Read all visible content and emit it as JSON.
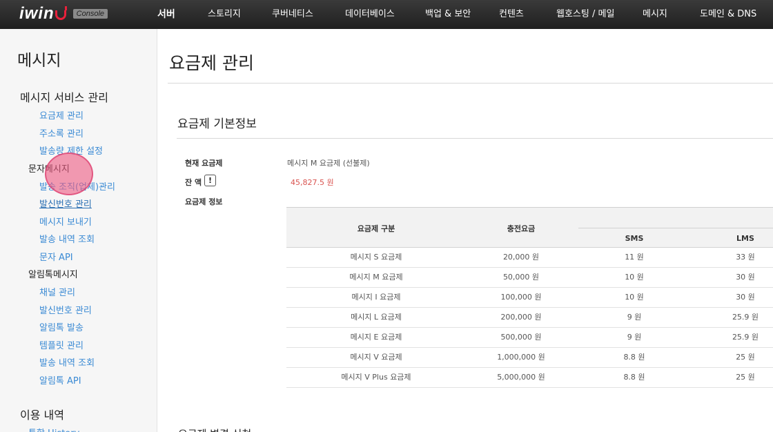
{
  "header": {
    "logo_text": "iwin",
    "console_label": "Console",
    "nav": [
      "서버",
      "스토리지",
      "쿠버네티스",
      "데이터베이스",
      "백업 & 보안",
      "컨텐츠",
      "웹호스팅 / 메일",
      "메시지",
      "도메인 & DNS"
    ]
  },
  "sidebar": {
    "title": "메시지",
    "groups": {
      "service": "메시지 서비스 관리",
      "service_items": [
        "요금제 관리",
        "주소록 관리",
        "발송량 제한 설정"
      ],
      "sms": "문자메시지",
      "sms_items": [
        "발송 조직(업체)관리",
        "발신번호 관리",
        "메시지 보내기",
        "발송 내역 조회",
        "문자 API"
      ],
      "alimtalk": "알림톡메시지",
      "alimtalk_items": [
        "채널 관리",
        "발신번호 관리",
        "알림톡 발송",
        "템플릿 관리",
        "발송 내역 조회",
        "알림톡 API"
      ],
      "usage": "이용 내역",
      "usage_items": [
        "통합 History"
      ]
    }
  },
  "main": {
    "page_title": "요금제 관리",
    "section_title": "요금제 기본정보",
    "current_plan_label": "현재 요금제",
    "current_plan_value": "메시지 M 요금제 (선불제)",
    "balance_label": "잔 액",
    "balance_icon": "!",
    "balance_value": "45,827.5 원",
    "plan_info_label": "요금제 정보",
    "next_section_title": "요금제 변경 신청"
  },
  "table": {
    "headers": {
      "plan": "요금제 구분",
      "charge": "충전요금",
      "sms": "SMS",
      "lms": "LMS"
    },
    "rows": [
      [
        "메시지 S 요금제",
        "20,000 원",
        "11 원",
        "33 원"
      ],
      [
        "메시지 M 요금제",
        "50,000 원",
        "10 원",
        "30 원"
      ],
      [
        "메시지 I 요금제",
        "100,000 원",
        "10 원",
        "30 원"
      ],
      [
        "메시지 L 요금제",
        "200,000 원",
        "9 원",
        "25.9 원"
      ],
      [
        "메시지 E 요금제",
        "500,000 원",
        "9 원",
        "25.9 원"
      ],
      [
        "메시지 V 요금제",
        "1,000,000 원",
        "8.8 원",
        "25 원"
      ],
      [
        "메시지 V Plus 요금제",
        "5,000,000 원",
        "8.8 원",
        "25 원"
      ]
    ]
  }
}
